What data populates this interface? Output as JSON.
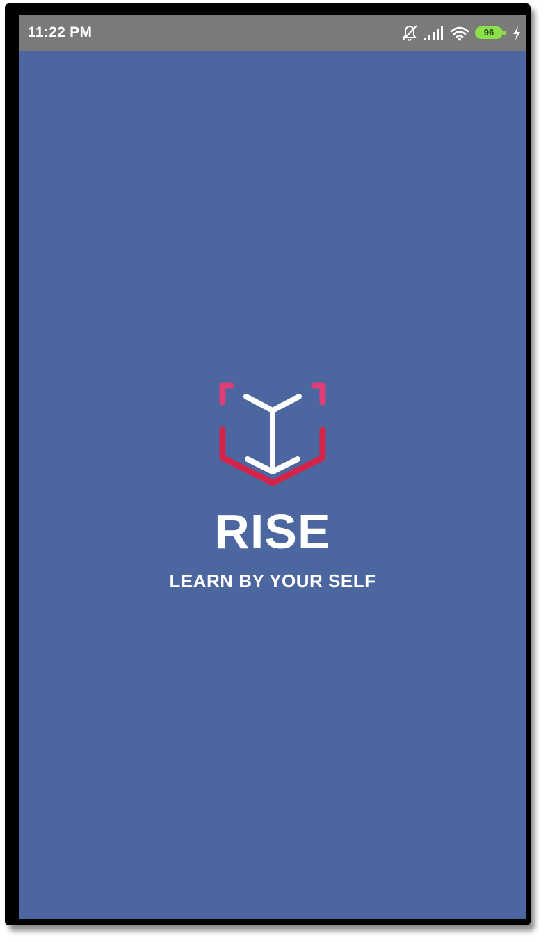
{
  "status_bar": {
    "time": "11:22 PM",
    "battery_level": "96",
    "icons": [
      "bell-off-icon",
      "signal-icon",
      "wifi-icon",
      "battery-icon",
      "charging-icon"
    ],
    "background": "#7a7a7a",
    "battery_color": "#8ce04b"
  },
  "splash": {
    "logo_icon": "book-icon",
    "title": "RISE",
    "tagline": "LEARN BY YOUR SELF",
    "background": "#4c67a0",
    "logo_colors": {
      "outline_light": "#e03d74",
      "outline_dark": "#d42449",
      "spine": "#ffffff"
    }
  }
}
